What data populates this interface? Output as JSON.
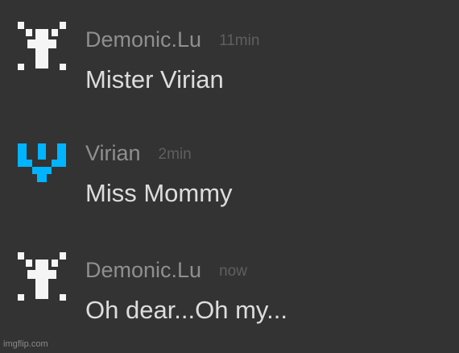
{
  "messages": [
    {
      "author": "Demonic.Lu",
      "time": "11min",
      "text": "Mister Virian",
      "avatar_icon": "white-cross-pixel-icon",
      "avatar_color": "#f5f5f5"
    },
    {
      "author": "Virian",
      "time": "2min",
      "text": "Miss Mommy",
      "avatar_icon": "cyan-v-pixel-icon",
      "avatar_color": "#00b4ff"
    },
    {
      "author": "Demonic.Lu",
      "time": "now",
      "text": "Oh dear...Oh my...",
      "avatar_icon": "white-cross-pixel-icon",
      "avatar_color": "#f5f5f5"
    }
  ],
  "watermark": "imgflip.com",
  "colors": {
    "background": "#333333",
    "author": "#8f8f8f",
    "timestamp": "#5f5f5f",
    "message_text": "#dddddd"
  }
}
